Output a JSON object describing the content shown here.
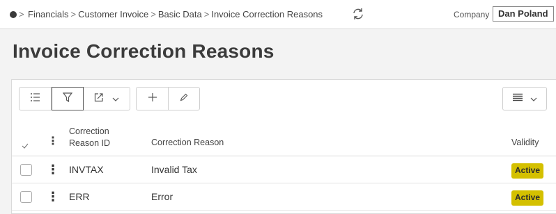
{
  "breadcrumb": {
    "items": [
      "Financials",
      "Customer Invoice",
      "Basic Data",
      "Invoice Correction Reasons"
    ],
    "separator": ">"
  },
  "company": {
    "label": "Company",
    "value": "Dan Poland"
  },
  "page": {
    "title": "Invoice Correction Reasons"
  },
  "toolbar": {
    "buttons": [
      "list-icon",
      "filter-icon",
      "export-icon",
      "dropdown-chevron-icon",
      "add-icon",
      "edit-icon",
      "column-view-icon"
    ]
  },
  "table": {
    "columns": {
      "id_line1": "Correction",
      "id_line2": "Reason ID",
      "reason": "Correction Reason",
      "validity": "Validity"
    },
    "rows": [
      {
        "id": "INVTAX",
        "reason": "Invalid Tax",
        "validity": "Active"
      },
      {
        "id": "ERR",
        "reason": "Error",
        "validity": "Active"
      }
    ]
  },
  "colors": {
    "active_badge": "#d4c000",
    "page_bg": "#f3f3f3"
  }
}
